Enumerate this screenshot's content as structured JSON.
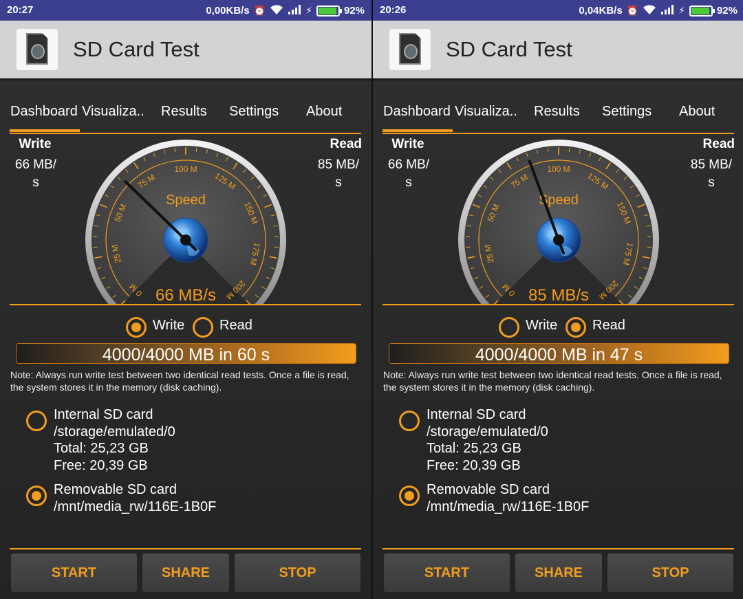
{
  "app": {
    "title": "SD Card Test"
  },
  "colors": {
    "accent": "#f29d1e",
    "status_bar": "#3c3f8f",
    "app_bar": "#d3d3d3",
    "panel": "#2a2a2a",
    "battery": "#4ccb38"
  },
  "icons": [
    "app-sd-card-icon",
    "alarm-icon",
    "wifi-icon",
    "signal-icon",
    "charging-icon",
    "battery-icon",
    "speedometer-icon",
    "globe-icon"
  ],
  "panels": [
    {
      "status": {
        "time": "20:27",
        "speed": "0,00KB/s",
        "battery_pct": "92%",
        "battery_level": 0.92
      },
      "tabs": [
        "Dashboard",
        "Visualiza..",
        "Results",
        "Settings",
        "About"
      ],
      "active_tab": 0,
      "write_label": "Write",
      "write_value": "66 MB/\ns",
      "read_label": "Read",
      "read_value": "85 MB/\ns",
      "gauge": {
        "label": "Speed",
        "reading": "66 MB/s",
        "value": 66,
        "max": 200,
        "ticks": [
          "0 M",
          "25 M",
          "50 M",
          "75 M",
          "100 M",
          "125 M",
          "150 M",
          "175 M",
          "200 M"
        ]
      },
      "mode": {
        "write": "Write",
        "read": "Read",
        "selected": "write"
      },
      "progress": {
        "text": "4000/4000 MB in 60 s",
        "fraction": 1.0
      },
      "note": "Note: Always run write test between two identical read tests. Once a file is read, the system stores it in the memory (disk caching).",
      "storage": [
        {
          "lines": [
            "Internal SD card",
            "/storage/emulated/0",
            "Total: 25,23 GB",
            "Free: 20,39 GB"
          ],
          "selected": false
        },
        {
          "lines": [
            "Removable SD card",
            "/mnt/media_rw/116E-1B0F"
          ],
          "selected": true
        }
      ],
      "buttons": {
        "start": "START",
        "share": "SHARE",
        "stop": "STOP"
      }
    },
    {
      "status": {
        "time": "20:26",
        "speed": "0,04KB/s",
        "battery_pct": "92%",
        "battery_level": 0.92
      },
      "tabs": [
        "Dashboard",
        "Visualiza..",
        "Results",
        "Settings",
        "About"
      ],
      "active_tab": 0,
      "write_label": "Write",
      "write_value": "66 MB/\ns",
      "read_label": "Read",
      "read_value": "85 MB/\ns",
      "gauge": {
        "label": "Speed",
        "reading": "85 MB/s",
        "value": 85,
        "max": 200,
        "ticks": [
          "0 M",
          "25 M",
          "50 M",
          "75 M",
          "100 M",
          "125 M",
          "150 M",
          "175 M",
          "200 M"
        ]
      },
      "mode": {
        "write": "Write",
        "read": "Read",
        "selected": "read"
      },
      "progress": {
        "text": "4000/4000 MB in 47 s",
        "fraction": 1.0
      },
      "note": "Note: Always run write test between two identical read tests. Once a file is read, the system stores it in the memory (disk caching).",
      "storage": [
        {
          "lines": [
            "Internal SD card",
            "/storage/emulated/0",
            "Total: 25,23 GB",
            "Free: 20,39 GB"
          ],
          "selected": false
        },
        {
          "lines": [
            "Removable SD card",
            "/mnt/media_rw/116E-1B0F"
          ],
          "selected": true
        }
      ],
      "buttons": {
        "start": "START",
        "share": "SHARE",
        "stop": "STOP"
      }
    }
  ]
}
